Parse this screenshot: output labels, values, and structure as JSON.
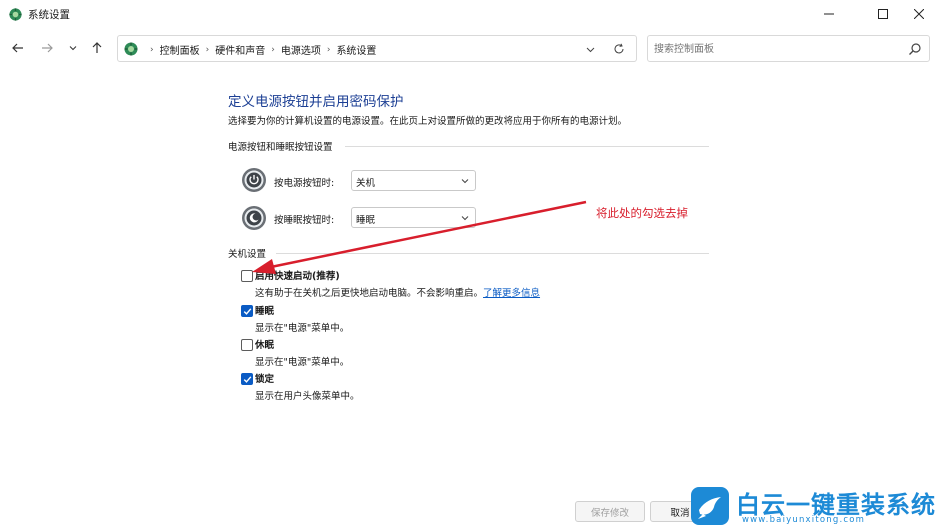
{
  "window": {
    "title": "系统设置"
  },
  "address_bar": {
    "breadcrumbs": [
      "控制面板",
      "硬件和声音",
      "电源选项",
      "系统设置"
    ]
  },
  "search": {
    "placeholder": "搜索控制面板"
  },
  "main": {
    "heading": "定义电源按钮并启用密码保护",
    "description": "选择要为你的计算机设置的电源设置。在此页上对设置所做的更改将应用于你所有的电源计划。",
    "power_section": {
      "title": "电源按钮和睡眠按钮设置",
      "power_button_label": "按电源按钮时:",
      "power_button_value": "关机",
      "sleep_button_label": "按睡眠按钮时:",
      "sleep_button_value": "睡眠"
    },
    "shutdown_section": {
      "title": "关机设置",
      "options": [
        {
          "label": "启用快速启动(推荐)",
          "note": "这有助于在关机之后更快地启动电脑。不会影响重启。",
          "link": "了解更多信息",
          "checked": false
        },
        {
          "label": "睡眠",
          "note": "显示在\"电源\"菜单中。",
          "checked": true
        },
        {
          "label": "休眠",
          "note": "显示在\"电源\"菜单中。",
          "checked": false
        },
        {
          "label": "锁定",
          "note": "显示在用户头像菜单中。",
          "checked": true
        }
      ]
    }
  },
  "annotation": {
    "text": "将此处的勾选去掉",
    "color": "#d81e2c"
  },
  "footer": {
    "save_label": "保存修改",
    "cancel_label": "取消"
  },
  "watermark": {
    "brand": "白云一键重装系统",
    "url": "www.baiyunxitong.com"
  },
  "colors": {
    "heading": "#1c3f94",
    "accent": "#0a5bc4"
  }
}
